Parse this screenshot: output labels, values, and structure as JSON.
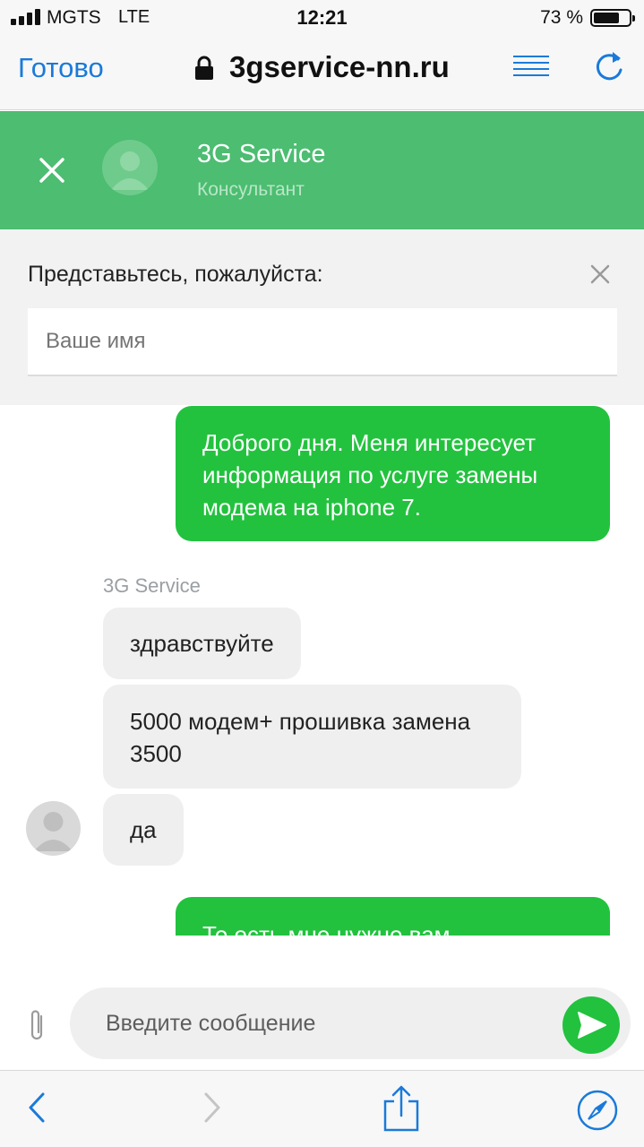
{
  "status_bar": {
    "carrier": "MGTS",
    "network": "LTE",
    "time": "12:21",
    "battery_text": "73 %",
    "battery_level": 0.73
  },
  "browser": {
    "done_label": "Готово",
    "url": "3gservice-nn.ru",
    "accent_color": "#1a7ad9"
  },
  "chat_header": {
    "agent_name": "3G Service",
    "agent_role": "Консультант",
    "background_color": "#4cbd71"
  },
  "intro_form": {
    "title": "Представьтесь, пожалуйста:",
    "name_placeholder": "Ваше имя"
  },
  "messages": {
    "outgoing_1": "Доброго дня. Меня интересует информация по услуге замены модема на iphone 7.",
    "sender_label": "3G Service",
    "incoming_1": "здравствуйте",
    "incoming_2": "5000 модем+ прошивка замена 3500",
    "incoming_3": "да",
    "outgoing_2_partial": "То есть мне нужно вам",
    "outgoing_color": "#22c23e",
    "incoming_color": "#efefef"
  },
  "composer": {
    "placeholder": "Введите сообщение",
    "icons": [
      "paperclip-icon",
      "send-icon"
    ]
  },
  "toolbar": {
    "icons": [
      "back-chevron-icon",
      "forward-chevron-icon",
      "share-icon",
      "safari-compass-icon"
    ]
  }
}
